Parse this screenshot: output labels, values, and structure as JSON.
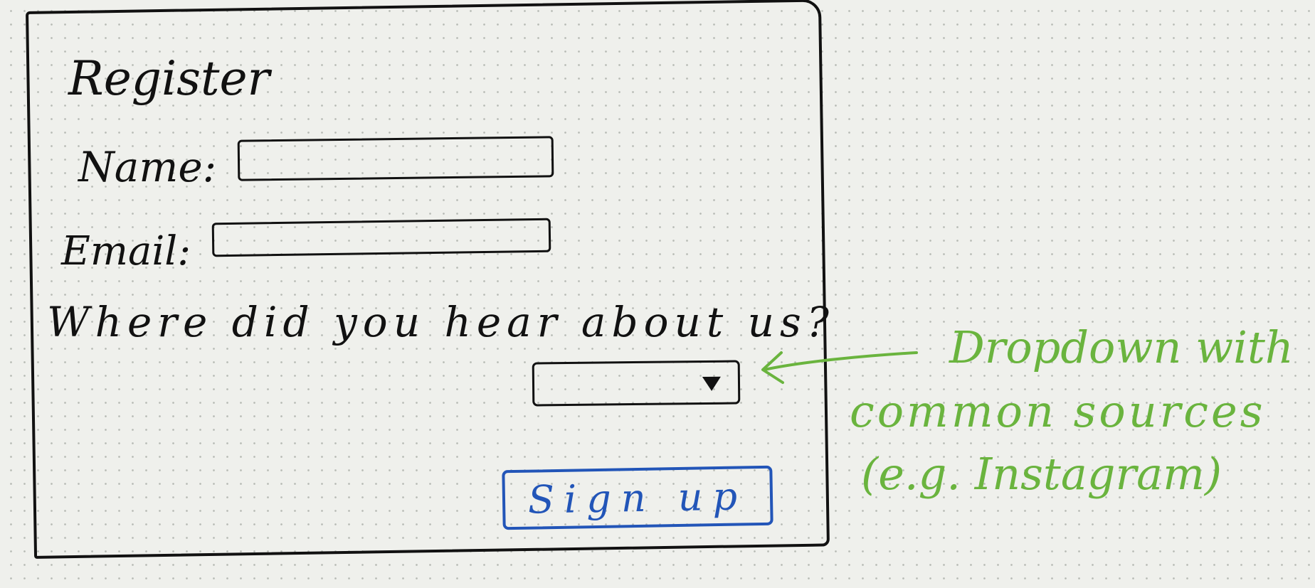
{
  "form": {
    "title": "Register",
    "name_label": "Name:",
    "email_label": "Email:",
    "question": "Where did you hear about us?",
    "name_value": "",
    "email_value": "",
    "dropdown_value": "",
    "signup_label": "Sign up"
  },
  "annotation": {
    "line1": "Dropdown with",
    "line2": "common sources",
    "line3": "(e.g. Instagram)"
  },
  "colors": {
    "ink": "#111111",
    "button_blue": "#2255b8",
    "annotation_green": "#6ab43e",
    "paper": "#eff0ec"
  },
  "icons": {
    "dropdown": "triangle-down",
    "annotation_arrow": "arrow-left"
  }
}
